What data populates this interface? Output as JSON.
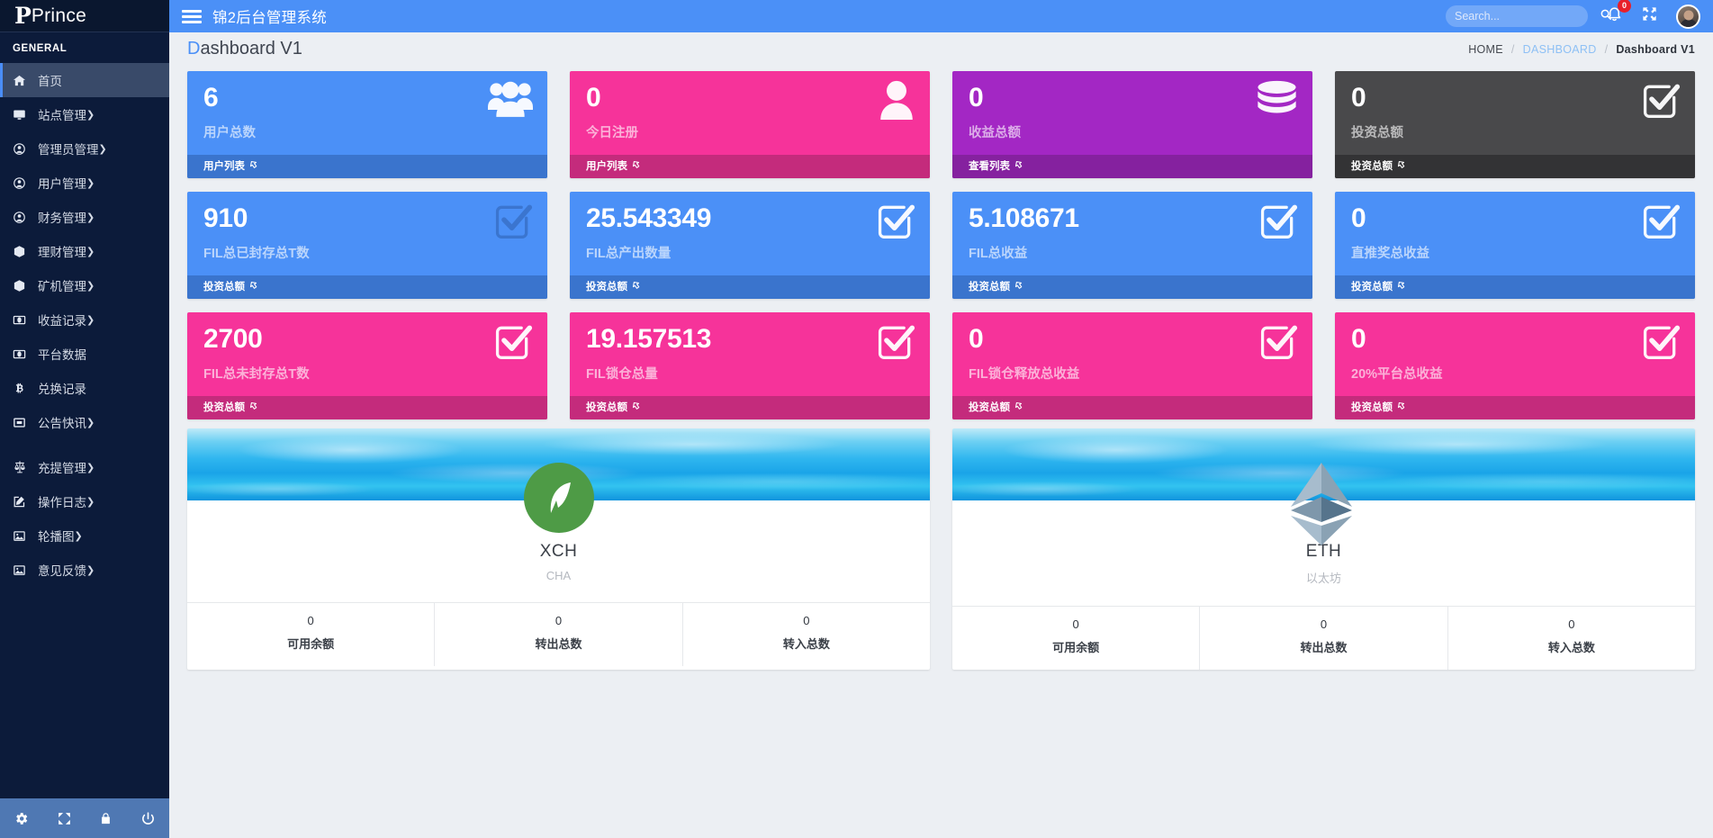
{
  "sidebar": {
    "brand": {
      "logo_letter": "P",
      "name": "Prince"
    },
    "section_title": "GENERAL",
    "items": [
      {
        "label": "首页",
        "icon": "home-icon",
        "caret": "",
        "active": true
      },
      {
        "label": "站点管理",
        "icon": "monitor-icon",
        "caret": "❯",
        "active": false
      },
      {
        "label": "管理员管理",
        "icon": "user-circle-icon",
        "caret": "❯",
        "active": false
      },
      {
        "label": "用户管理",
        "icon": "user-circle-icon",
        "caret": "❯",
        "active": false
      },
      {
        "label": "财务管理",
        "icon": "user-circle-icon",
        "caret": "❯",
        "active": false
      },
      {
        "label": "理财管理",
        "icon": "box-icon",
        "caret": "❯",
        "active": false
      },
      {
        "label": "矿机管理",
        "icon": "box-icon",
        "caret": "❯",
        "active": false
      },
      {
        "label": "收益记录",
        "icon": "money-icon",
        "caret": "❯",
        "active": false
      },
      {
        "label": "平台数据",
        "icon": "money-icon",
        "caret": "",
        "active": false
      },
      {
        "label": "兑换记录",
        "icon": "bitcoin-icon",
        "caret": "",
        "active": false
      },
      {
        "label": "公告快讯",
        "icon": "window-icon",
        "caret": "❯",
        "active": false
      },
      {
        "label": "充提管理",
        "icon": "balance-icon",
        "caret": "❯",
        "active": false
      },
      {
        "label": "操作日志",
        "icon": "edit-icon",
        "caret": "❯",
        "active": false
      },
      {
        "label": "轮播图",
        "icon": "image-icon",
        "caret": "❯",
        "active": false
      },
      {
        "label": "意见反馈",
        "icon": "image-icon",
        "caret": "❯",
        "active": false
      }
    ],
    "footer_icons": [
      "gear-icon",
      "expand-icon",
      "lock-icon",
      "power-icon"
    ]
  },
  "topbar": {
    "menu_icon": "hamburger-icon",
    "title": "锦2后台管理系统",
    "search_placeholder": "Search...",
    "search_value": "",
    "search_icon": "search-icon",
    "notification_icon": "bell-icon",
    "notification_count": "0",
    "fullscreen_icon": "expand-arrows-icon",
    "avatar": "user-avatar"
  },
  "page": {
    "title_first": "D",
    "title_rest": "ashboard V1",
    "breadcrumb": {
      "home": "HOME",
      "sep1": "/",
      "dashboard": "DASHBOARD",
      "sep2": "/",
      "current": "Dashboard V1"
    }
  },
  "stats": [
    {
      "value": "6",
      "label": "用户总数",
      "footer": "用户列表",
      "icon": "users-icon",
      "color": "blue"
    },
    {
      "value": "0",
      "label": "今日注册",
      "footer": "用户列表",
      "icon": "user-icon",
      "color": "pink"
    },
    {
      "value": "0",
      "label": "收益总额",
      "footer": "查看列表",
      "icon": "database-icon",
      "color": "purple"
    },
    {
      "value": "0",
      "label": "投资总额",
      "footer": "投资总额",
      "icon": "check-box-icon",
      "color": "dark"
    },
    {
      "value": "910",
      "label": "FIL总已封存总T数",
      "footer": "投资总额",
      "icon": "check-box-icon",
      "color": "blue"
    },
    {
      "value": "25.543349",
      "label": "FIL总产出数量",
      "footer": "投资总额",
      "icon": "check-box-icon",
      "color": "blue"
    },
    {
      "value": "5.108671",
      "label": "FIL总收益",
      "footer": "投资总额",
      "icon": "check-box-icon",
      "color": "blue"
    },
    {
      "value": "0",
      "label": "直推奖总收益",
      "footer": "投资总额",
      "icon": "check-box-icon",
      "color": "blue"
    },
    {
      "value": "2700",
      "label": "FIL总未封存总T数",
      "footer": "投资总额",
      "icon": "check-box-icon",
      "color": "pink"
    },
    {
      "value": "19.157513",
      "label": "FIL锁仓总量",
      "footer": "投资总额",
      "icon": "check-box-icon",
      "color": "pink"
    },
    {
      "value": "0",
      "label": "FIL锁仓释放总收益",
      "footer": "投资总额",
      "icon": "check-box-icon",
      "color": "pink"
    },
    {
      "value": "0",
      "label": "20%平台总收益",
      "footer": "投资总额",
      "icon": "check-box-icon",
      "color": "pink"
    }
  ],
  "coins": [
    {
      "symbol": "XCH",
      "name": "CHA",
      "logo": "chia-leaf-icon",
      "stats": [
        {
          "value": "0",
          "label": "可用余额"
        },
        {
          "value": "0",
          "label": "转出总数"
        },
        {
          "value": "0",
          "label": "转入总数"
        }
      ]
    },
    {
      "symbol": "ETH",
      "name": "以太坊",
      "logo": "ethereum-icon",
      "stats": [
        {
          "value": "0",
          "label": "可用余额"
        },
        {
          "value": "0",
          "label": "转出总数"
        },
        {
          "value": "0",
          "label": "转入总数"
        }
      ]
    }
  ],
  "colors": {
    "accent": "#4b90f7",
    "pink": "#f6339a",
    "purple": "#a327c4",
    "dark": "#49494b",
    "sidebar": "#0c1b3a",
    "badge": "#e8202a"
  }
}
